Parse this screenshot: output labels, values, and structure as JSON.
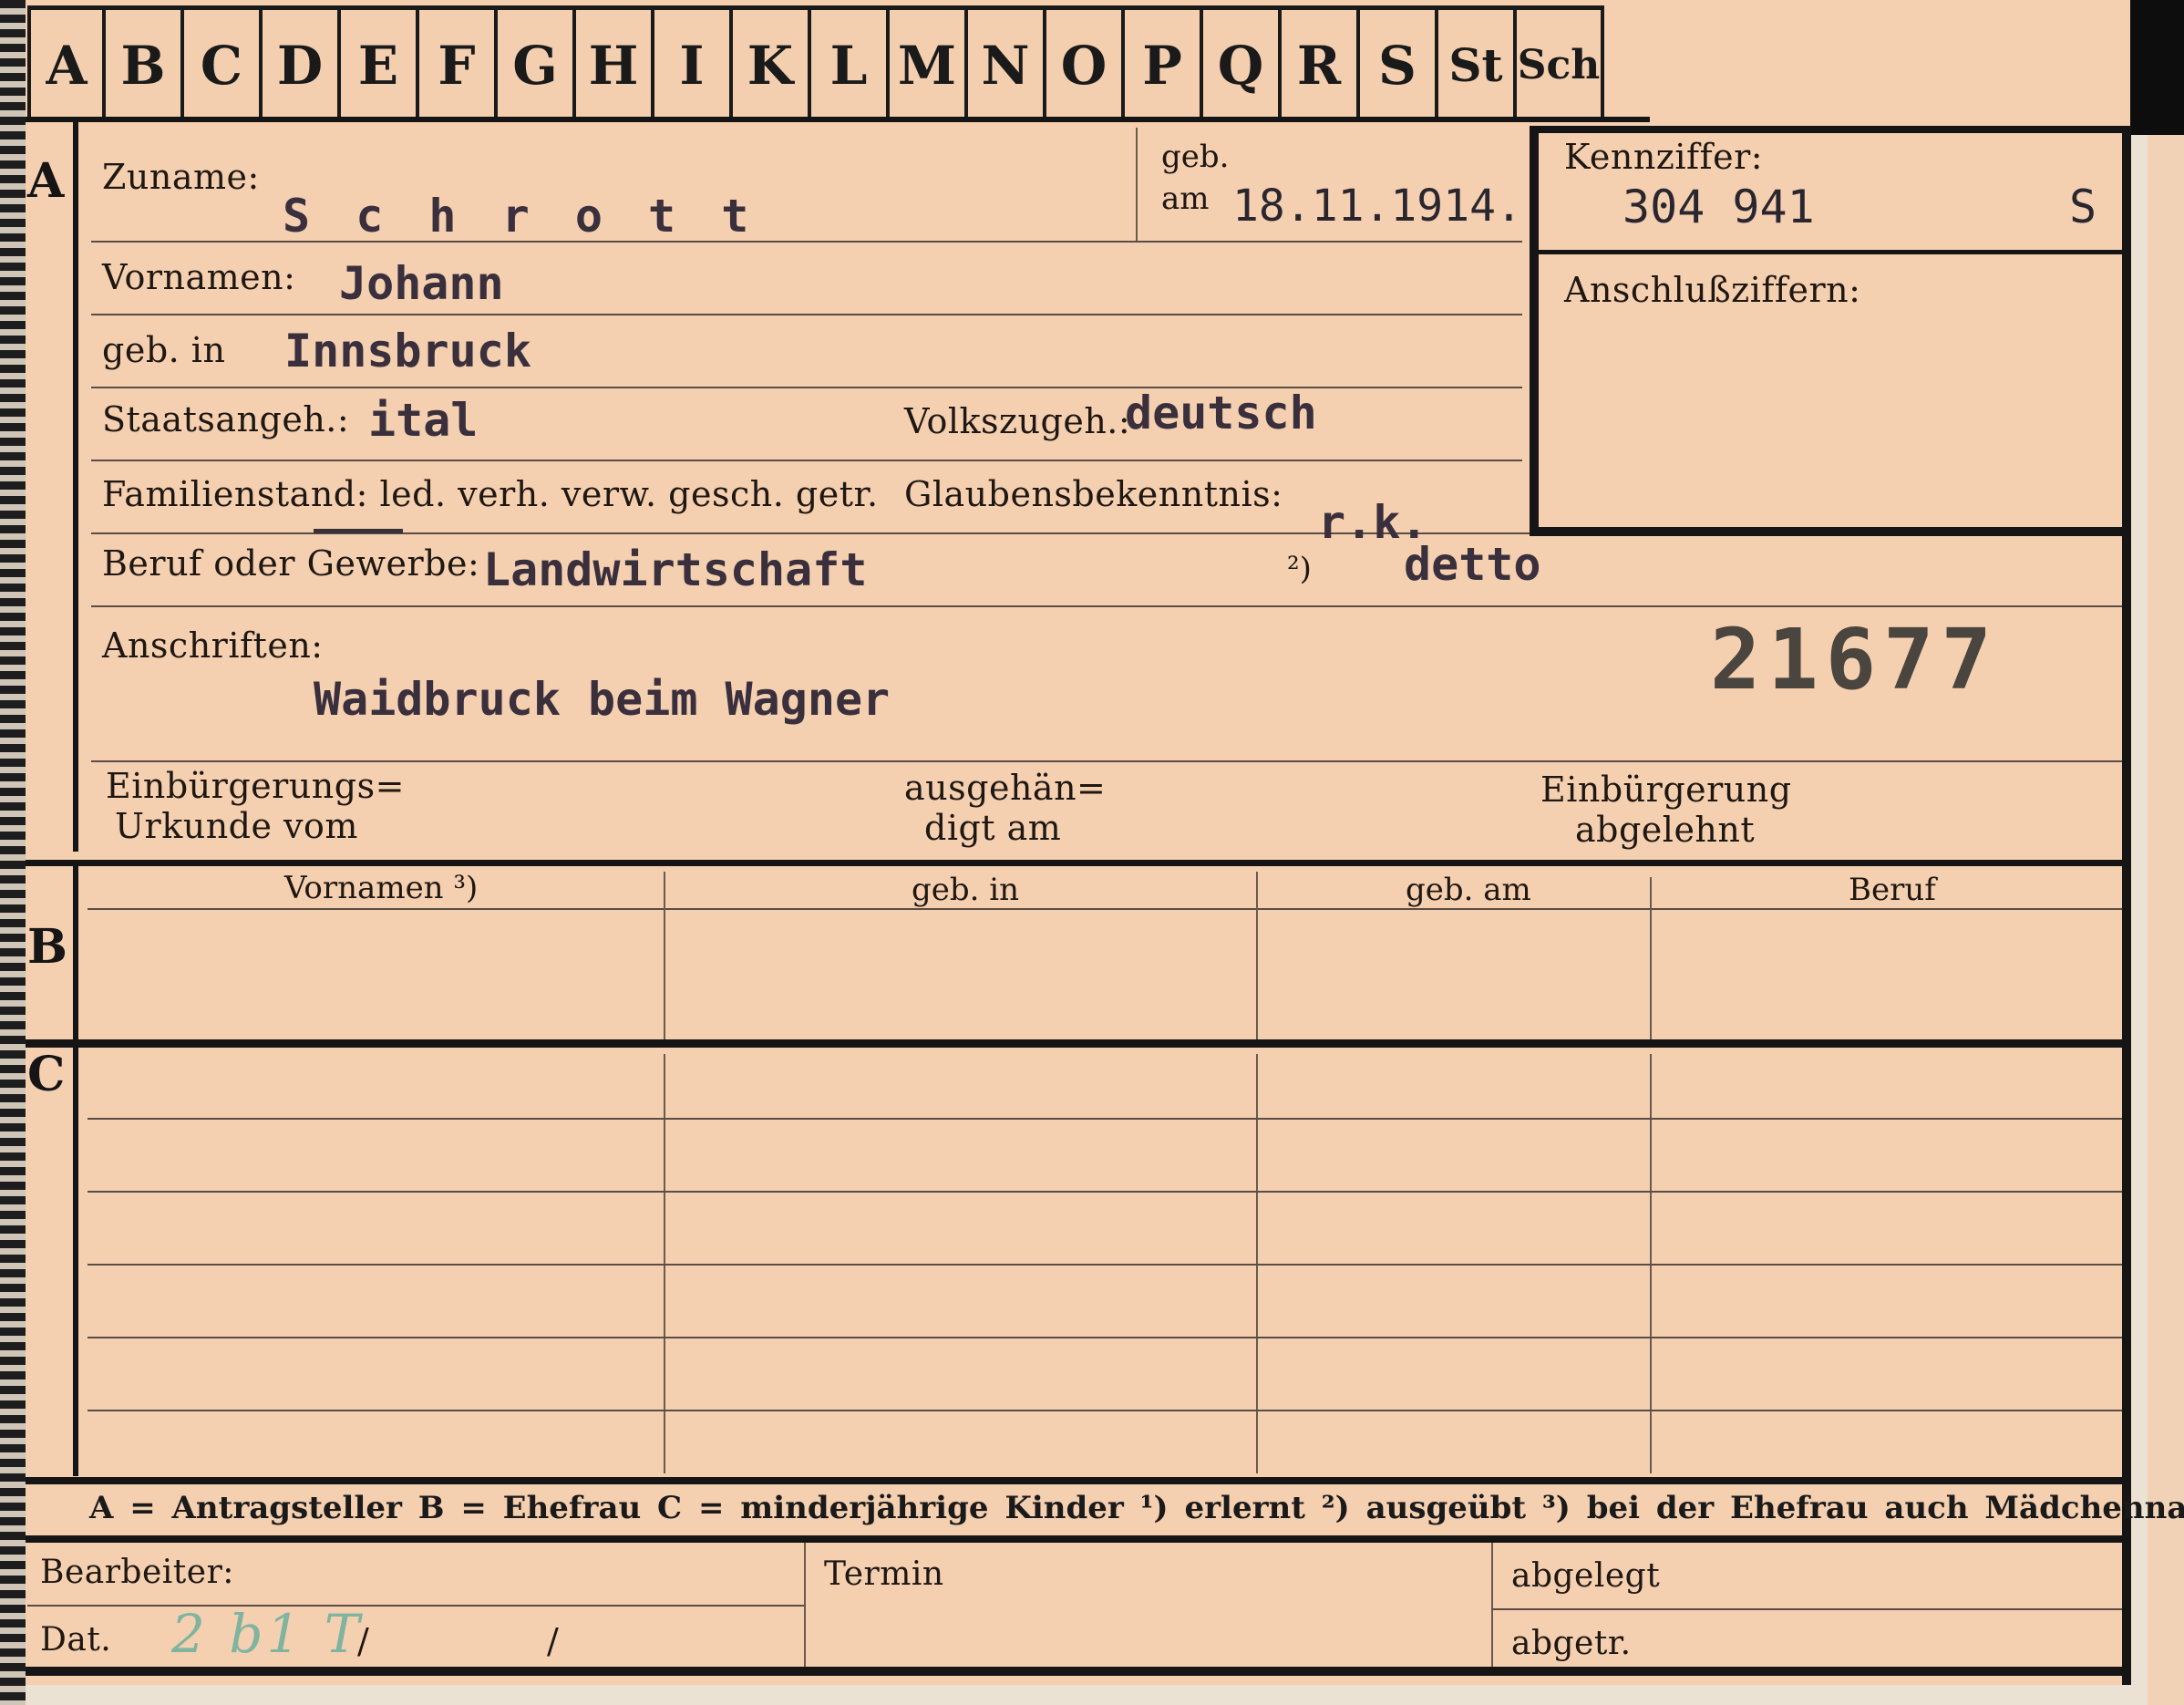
{
  "tabs": [
    "A",
    "B",
    "C",
    "D",
    "E",
    "F",
    "G",
    "H",
    "I",
    "K",
    "L",
    "M",
    "N",
    "O",
    "P",
    "Q",
    "R",
    "S",
    "St",
    "Sch"
  ],
  "section_letters": {
    "a": "A",
    "b": "B",
    "c": "C"
  },
  "form": {
    "zuname_label": "Zuname:",
    "zuname_value": "S c h r o t t",
    "geb_label": "geb.",
    "am_label": "am",
    "geb_am_value": "18.11.1914.",
    "kennziffer_label": "Kennziffer:",
    "kennziffer_value": "304 941",
    "kennziffer_suffix": "S",
    "anschluss_label": "Anschlußziffern:",
    "vornamen_label": "Vornamen:",
    "vornamen_value": "Johann",
    "gebin_label": "geb. in",
    "gebin_value": "Innsbruck",
    "staats_label": "Staatsangeh.:",
    "staats_value": "ital",
    "volks_label": "Volkszugeh.:",
    "volks_value": "deutsch",
    "familien_label": "Familienstand: led. verh. verw. gesch. getr.",
    "glauben_label": "Glaubensbekenntnis:",
    "glauben_value": "r.k.",
    "beruf_label": "Beruf oder Gewerbe:",
    "beruf_value": "Landwirtschaft",
    "footnote2": "²)",
    "detto_value": "detto",
    "anschriften_label": "Anschriften:",
    "anschriften_value": "Waidbruck beim Wagner",
    "stamp_number": "21677",
    "einb_label_1": "Einbürgerungs=",
    "einb_label_2": "Urkunde vom",
    "ausgeh_label_1": "ausgehän=",
    "ausgeh_label_2": "digt am",
    "einb_abgelehnt_1": "Einbürgerung",
    "einb_abgelehnt_2": "abgelehnt"
  },
  "table_b": {
    "headers": [
      "Vornamen ³)",
      "geb. in",
      "geb. am",
      "Beruf"
    ]
  },
  "legend": "A = Antragsteller    B = Ehefrau    C = minderjährige Kinder    ¹) erlernt    ²) ausgeübt    ³) bei der Ehefrau auch Mädchenname",
  "footer": {
    "bearbeiter_label": "Bearbeiter:",
    "dat_label": "Dat.",
    "dat_slash1": "/",
    "dat_slash2": "/",
    "dat_handwritten": "2 b1 T",
    "termin_label": "Termin",
    "abgelegt_label": "abgelegt",
    "abgetr_label": "abgetr."
  }
}
